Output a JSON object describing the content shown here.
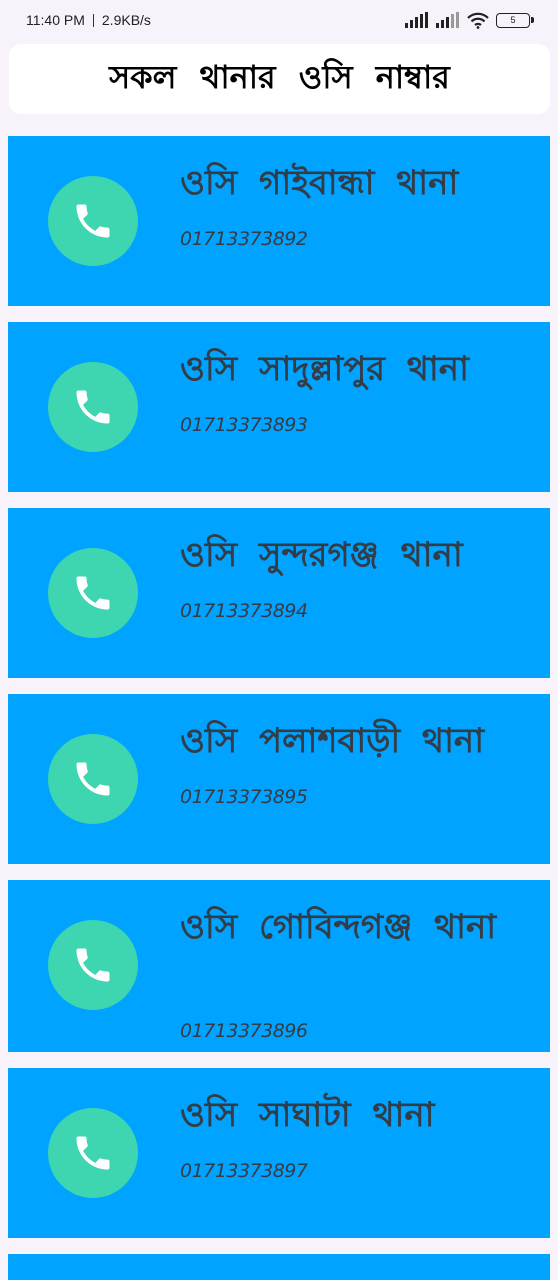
{
  "status_bar": {
    "time": "11:40 PM",
    "speed": "2.9KB/s",
    "battery": "5"
  },
  "header": {
    "title": "সকল থানার ওসি নাম্বার"
  },
  "contacts": [
    {
      "name": "ওসি গাইবান্ধা থানা",
      "phone": "01713373892"
    },
    {
      "name": "ওসি সাদুল্লাপুর থানা",
      "phone": "01713373893"
    },
    {
      "name": "ওসি সুন্দরগঞ্জ থানা",
      "phone": "01713373894"
    },
    {
      "name": "ওসি পলাশবাড়ী থানা",
      "phone": "01713373895"
    },
    {
      "name": "ওসি গোবিন্দগঞ্জ থানা",
      "phone": "01713373896"
    },
    {
      "name": "ওসি সাঘাটা থানা",
      "phone": "01713373897"
    }
  ],
  "icons": {
    "call": "phone-icon"
  },
  "colors": {
    "card_background": "#00a3ff",
    "call_circle": "#3dd6b0",
    "text": "#333d48",
    "page_background": "#f8f2fb"
  }
}
